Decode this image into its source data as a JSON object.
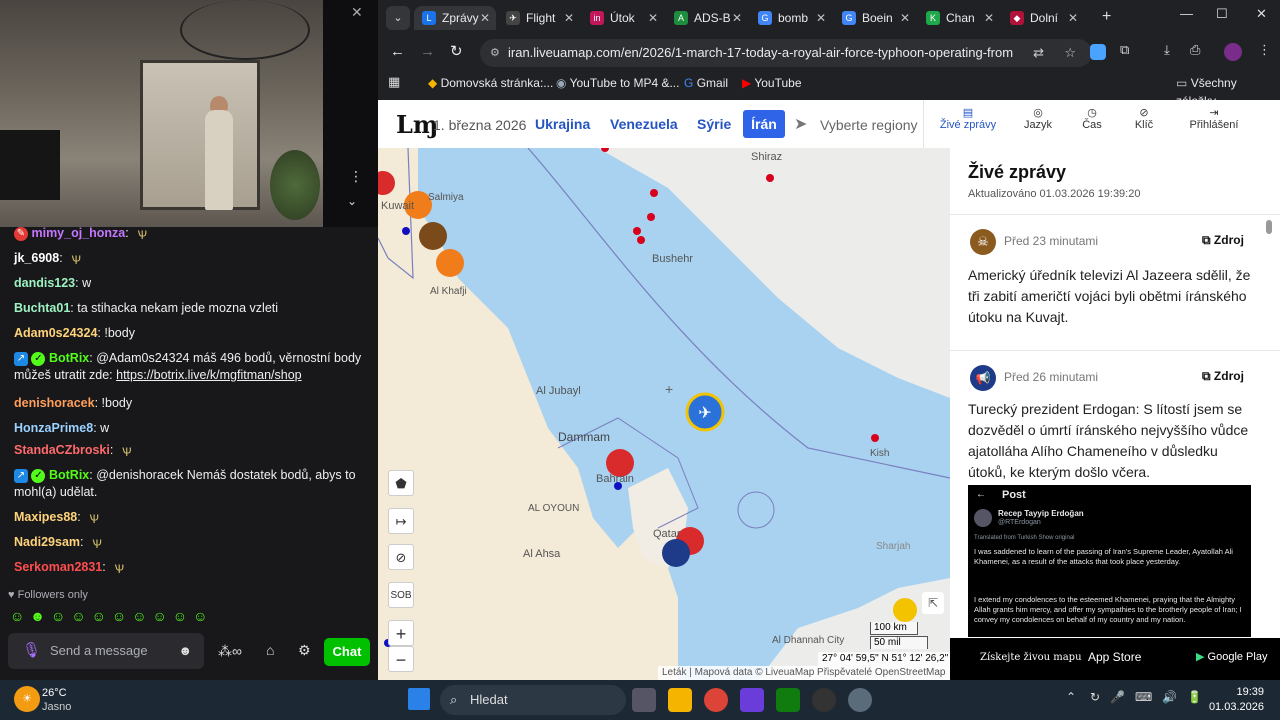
{
  "chat": {
    "messages": [
      {
        "user": "mimy_oj_honza",
        "text": "",
        "color": "#c576ff",
        "emote": true
      },
      {
        "user": "jk_6908",
        "text": "",
        "color": "#ffffff",
        "emote": true
      },
      {
        "user": "dandis123",
        "text": "w",
        "color": "#9ef2c1"
      },
      {
        "user": "Buchta01",
        "text": "ta stihacka nekam jede mozna vzleti",
        "color": "#9ef2c1"
      },
      {
        "user": "Adam0s24324",
        "text": "!body",
        "color": "#ffd37a"
      },
      {
        "user": "BotRix",
        "text": "@Adam0s24324 máš 496 bodů, věrnostní body můžeš utratit zde: ",
        "link": "https://botrix.live/k/mgfitman/shop",
        "color": "#53fc18"
      },
      {
        "user": "denishoracek",
        "text": "!body",
        "color": "#ff9f5a"
      },
      {
        "user": "HonzaPrime8",
        "text": "w",
        "color": "#9ad1ff"
      },
      {
        "user": "StandaCZbroski",
        "text": "",
        "color": "#ff6a6a",
        "emote": true
      },
      {
        "user": "BotRix",
        "text": "@denishoracek Nemáš dostatek bodů, abys to mohl(a) udělat.",
        "color": "#53fc18"
      },
      {
        "user": "Maxipes88",
        "text": "",
        "color": "#ffd37a",
        "emote": true
      },
      {
        "user": "Nadi29sam",
        "text": "",
        "color": "#ffd37a",
        "emote": true
      },
      {
        "user": "Serkoman2831",
        "text": "",
        "color": "#ff4d4d",
        "emote": true
      }
    ],
    "followers_only": "Followers only",
    "send_placeholder": "Send a message",
    "chat_button": "Chat"
  },
  "browser": {
    "tabs": [
      {
        "label": "Zprávy",
        "color": "#1a73e8",
        "icon": "L"
      },
      {
        "label": "Flight",
        "color": "#444",
        "icon": "✈"
      },
      {
        "label": "Útok",
        "color": "#c2185b",
        "icon": "in"
      },
      {
        "label": "ADS-B",
        "color": "#1e8e3e",
        "icon": "A"
      },
      {
        "label": "bomb",
        "color": "#4285f4",
        "icon": "G"
      },
      {
        "label": "Boein",
        "color": "#4285f4",
        "icon": "G"
      },
      {
        "label": "Chan",
        "color": "#1ea84a",
        "icon": "K"
      },
      {
        "label": "Dolní",
        "color": "#b0123a",
        "icon": "◆"
      }
    ],
    "url": "iran.liveuamap.com/en/2026/1-march-17-today-a-royal-air-force-typhoon-operating-from",
    "bookmarks": [
      "Domovská stránka:...",
      "YouTube to MP4 &...",
      "Gmail",
      "YouTube"
    ],
    "all_bookmarks": "Všechny záložky"
  },
  "site": {
    "date": "1. března 2026",
    "regions": [
      "Ukrajina",
      "Venezuela",
      "Sýrie",
      "Írán"
    ],
    "select_regions": "Vyberte regiony",
    "menu": [
      "Živé zprávy",
      "Jazyk",
      "Čas",
      "Klíč",
      "Přihlášení"
    ]
  },
  "map": {
    "labels": [
      "Shiraz",
      "Bushehr",
      "Al Jubayl",
      "Dammam",
      "Bahrain",
      "AL OYOUN",
      "Al Ahsa",
      "Qatar",
      "Kish",
      "Sharjah",
      "Al Khafji",
      "Kuwait",
      "Salmiya",
      "Al Dhannah City"
    ],
    "scale_km": "100 km",
    "scale_mi": "50 mil",
    "coords": "27° 04' 59,5\" N 51° 12' 26,2\" E",
    "attribution": "Leták | Mapová data © LiveuaMap Přispěvatelé OpenStreetMap",
    "sob_label": "SOB"
  },
  "news": {
    "title": "Živé zprávy",
    "updated": "Aktualizováno 01.03.2026 19:39:20",
    "items": [
      {
        "time": "Před 23 minutami",
        "source": "Zdroj",
        "text": "Americký úředník televizi Al Jazeera sdělil, že tři zabití američtí vojáci byli obětmi íránského útoku na Kuvajt."
      },
      {
        "time": "Před 26 minutami",
        "source": "Zdroj",
        "text": "Turecký prezident Erdogan: S lítostí jsem se dozvěděl o úmrtí íránského nejvyššího vůdce ajatolláha Alího Chameneího v důsledku útoků, ke kterým došlo včera."
      }
    ],
    "tweet": {
      "header": "Post",
      "name": "Recep Tayyip Erdoğan",
      "handle": "@RTErdogan",
      "translated": "Translated from Turkish  Show original",
      "p1": "I was saddened to learn of the passing of Iran's Supreme Leader, Ayatollah Ali Khamenei, as a result of the attacks that took place yesterday.",
      "p2": "I extend my condolences to the esteemed Khamenei, praying that the Almighty Allah grants him mercy, and offer my sympathies to the brotherly people of Iran; I convey my condolences on behalf of my country and my nation."
    },
    "app_promo": "Získejte živou mapu",
    "app_store": "App Store",
    "google_play": "Google Play"
  },
  "taskbar": {
    "temp": "26°C",
    "weather": "Jasno",
    "search": "Hledat",
    "time": "19:39",
    "date": "01.03.2026"
  }
}
